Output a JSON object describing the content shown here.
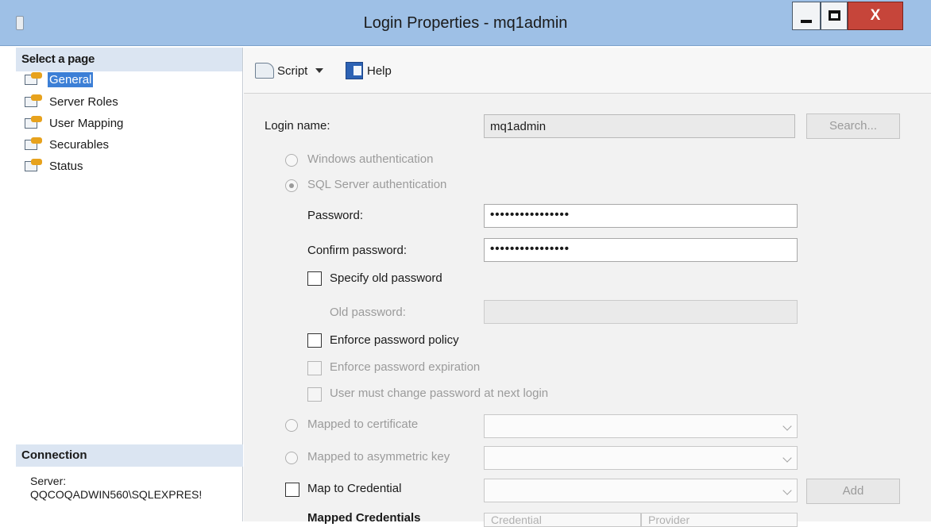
{
  "window": {
    "title": "Login Properties - mq1admin",
    "close_glyph": "X"
  },
  "sidebar": {
    "header": "Select a page",
    "items": [
      {
        "label": "General",
        "selected": true
      },
      {
        "label": "Server Roles"
      },
      {
        "label": "User Mapping"
      },
      {
        "label": "Securables"
      },
      {
        "label": "Status"
      }
    ]
  },
  "connection": {
    "header": "Connection",
    "server_label": "Server:",
    "server_value": "QQCOQADWIN560\\SQLEXPRES!"
  },
  "toolbar": {
    "script_label": "Script",
    "help_label": "Help"
  },
  "form": {
    "login_name_label": "Login name:",
    "login_name_value": "mq1admin",
    "search_button": "Search...",
    "windows_auth": "Windows authentication",
    "sql_auth": "SQL Server authentication",
    "password_label": "Password:",
    "password_value": "••••••••••••••••",
    "confirm_label": "Confirm password:",
    "confirm_value": "••••••••••••••••",
    "specify_old": "Specify old password",
    "old_password_label": "Old password:",
    "enforce_policy": "Enforce password policy",
    "enforce_expiration": "Enforce password expiration",
    "must_change": "User must change password at next login",
    "mapped_cert": "Mapped to certificate",
    "mapped_asym": "Mapped to asymmetric key",
    "map_credential": "Map to Credential",
    "add_button": "Add",
    "mapped_credentials": "Mapped Credentials",
    "grid_col1": "Credential",
    "grid_col2": "Provider"
  },
  "colors": {
    "titlebar": "#9ec0e6",
    "selection": "#3c7fd6",
    "close_button": "#c6453a"
  }
}
